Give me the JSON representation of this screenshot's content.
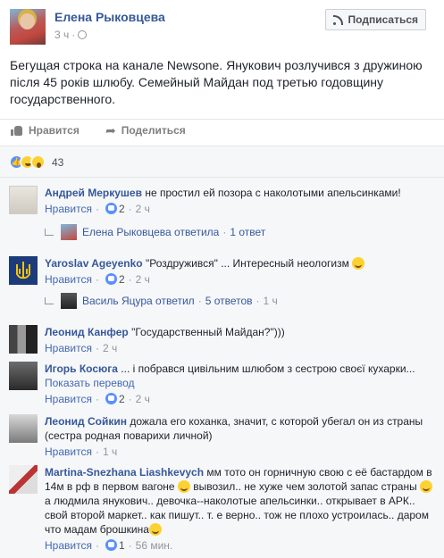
{
  "header": {
    "author": "Елена Рыковцева",
    "time": "3 ч",
    "subscribe_label": "Подписаться"
  },
  "post_text": "Бегущая строка на канале Newsone. Янукович розлучився з дружиною після 45 років шлюбу. Семейный Майдан под третью годовщину государственного.",
  "actions": {
    "like": "Нравится",
    "share": "Поделиться"
  },
  "reactions": {
    "count": "43",
    "types": [
      "like",
      "haha",
      "wow"
    ]
  },
  "colors": {
    "link": "#365899",
    "accent": "#4267b2",
    "meta": "#90949c",
    "bg": "#f6f7f9"
  },
  "comments": [
    {
      "author": "Андрей Меркушев",
      "text": " не простил ей позора с наколотыми апельсинками!",
      "like": "Нравится",
      "likes": "2",
      "time": "2 ч",
      "reply": {
        "who": "Елена Рыковцева ответила",
        "count": "1 ответ"
      }
    },
    {
      "author": "Yaroslav Ageyenko",
      "text": " \"Роздружився\" ... Интересный неологизм ",
      "like": "Нравится",
      "likes": "2",
      "time": "2 ч",
      "reply": {
        "who": "Василь Яцура ответил",
        "count": "5 ответов",
        "time": "1 ч"
      }
    },
    {
      "author": "Леонид Канфер",
      "text": " \"Государственный Майдан?\")))",
      "like": "Нравится",
      "time": "2 ч"
    },
    {
      "author": "Игорь Косюга",
      "text": " ... і побрався цивільним шлюбом з сестрою своєї кухарки...",
      "translate": "Показать перевод",
      "like": "Нравится",
      "likes": "2",
      "time": "2 ч"
    },
    {
      "author": "Леонид Сойкин",
      "text": " дожала его коханка, значит, с которой убегал он из страны (сестра родная поварихи личной)",
      "like": "Нравится",
      "time": "1 ч"
    },
    {
      "author": "Martina-Snezhana Liashkevych",
      "text_parts": [
        " мм тото он горничную свою с её бастардом в 14м в рф в первом вагоне ",
        " вывозил.. не хуже чем золотой запас страны ",
        " а людмила янукович.. девочка--наколотые апельсинки.. открывает в АРК.. свой второй маркет.. как пишут.. т. е верно.. тож не плохо устроилась.. даром что мадам брошкина"
      ],
      "like": "Нравится",
      "likes": "1",
      "time": "56 мин."
    }
  ]
}
